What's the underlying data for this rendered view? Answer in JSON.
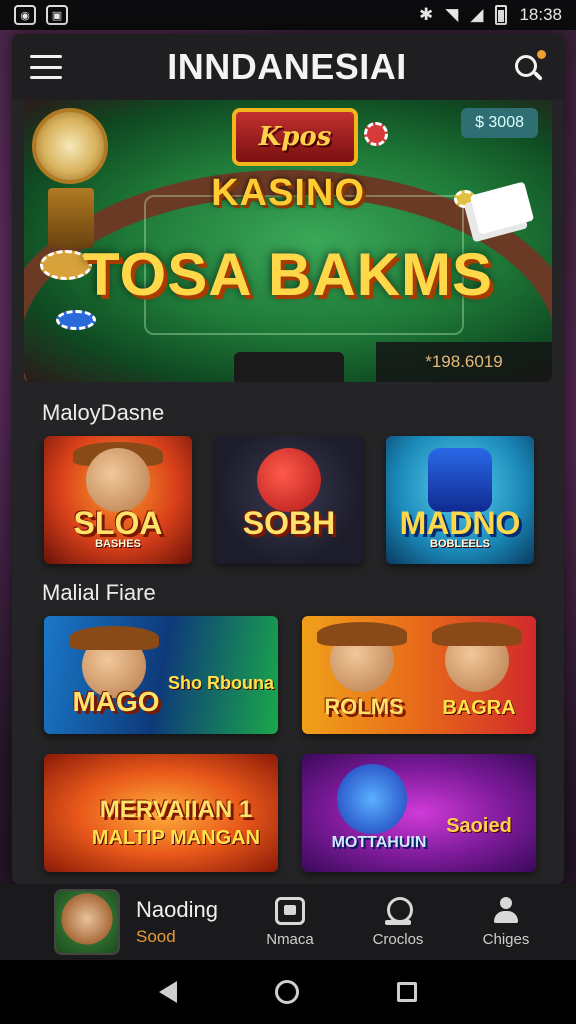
{
  "status_bar": {
    "time": "18:38",
    "left_icons": [
      "camera-icon",
      "image-icon"
    ],
    "right_icons": [
      "bluetooth-icon",
      "wifi-icon",
      "signal-icon",
      "battery-icon"
    ]
  },
  "app_bar": {
    "title": "INNDANESIAI",
    "menu_icon": "hamburger-menu-icon",
    "search_icon": "search-icon"
  },
  "hero": {
    "logo_text": "Kpos",
    "kasino_text": "KASINO",
    "headline": "TOSA BAKMS",
    "badge": "$ 3008",
    "jackpot": "*198.6019"
  },
  "sections": {
    "first_title": "MaloyDasne",
    "second_title": "Malial Fiare"
  },
  "games_row1": [
    {
      "label": "SLOA",
      "sub": "BASHES"
    },
    {
      "label": "SOBH",
      "sub": ""
    },
    {
      "label": "MADNO",
      "sub": "BOBLEELS"
    }
  ],
  "games_row2": [
    {
      "label": "MAGO",
      "sub": "Sho Rbouna"
    },
    {
      "label": "ROLMS",
      "sub": "BAGRA"
    }
  ],
  "games_row3": [
    {
      "label": "MERVAIIAN 1",
      "sub": "MALTIP MANGAN"
    },
    {
      "label": "MOTTAHUIN",
      "sub": "Saoied"
    }
  ],
  "bottom_nav": {
    "featured_title": "Naoding",
    "featured_sub": "Sood",
    "items": [
      {
        "label": "Nmaca",
        "icon": "game-box-icon"
      },
      {
        "label": "Croclos",
        "icon": "chip-stack-icon"
      },
      {
        "label": "Chiges",
        "icon": "user-profile-icon"
      }
    ]
  },
  "system_nav": {
    "back_icon": "back-icon",
    "home_icon": "home-icon",
    "recent_icon": "recent-apps-icon"
  }
}
